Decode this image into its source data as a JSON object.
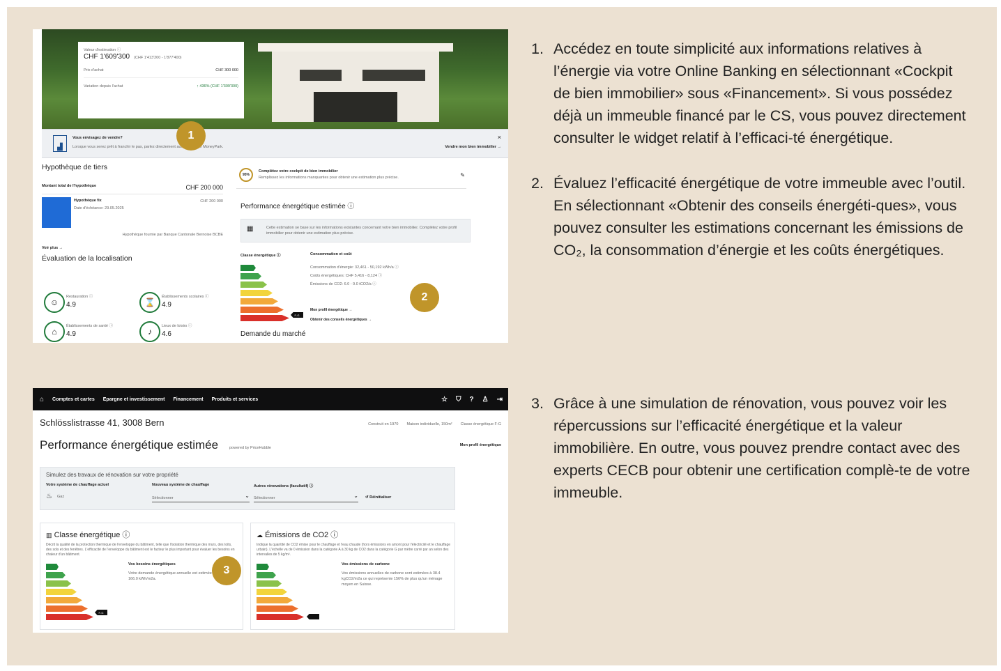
{
  "steps": [
    {
      "num": "1.",
      "text": "Accédez en toute simplicité aux informations relatives à l’énergie via votre Online Banking en sélectionnant «Cockpit de bien immobilier» sous «Financement». Si vous possédez déjà un immeuble financé par le CS, vous pouvez directement consulter le widget relatif à l’efficaci-té énergétique."
    },
    {
      "num": "2.",
      "text": "Évaluez l’efficacité énergétique de votre immeuble avec l’outil. En sélectionnant «Obtenir des conseils énergéti-ques», vous pouvez consulter les estimations concernant les émissions de CO₂, la consommation d’énergie et les coûts énergétiques."
    },
    {
      "num": "3.",
      "text": "Grâce à une simulation de rénovation, vous pouvez voir les répercussions sur l’efficacité énergétique et la valeur immobilière. En outre, vous pouvez prendre contact avec des experts CECB pour obtenir une certification complè-te de votre immeuble."
    }
  ],
  "badges": [
    "1",
    "2",
    "3"
  ],
  "shot1": {
    "estimate_label": "Valeur d'estimation ⓘ",
    "estimate_value": "CHF 1'609'300",
    "estimate_range": "(CHF 1'413'200 - 1'877'400)",
    "purchase_label": "Prix d'achat",
    "purchase_value": "CHF 300 000",
    "change_label": "Variation depuis l'achat",
    "change_value": "↑ 436% (CHF 1'309'300)",
    "banner_title": "Vous envisagez de vendre?",
    "banner_text": "Lorsque vous serez prêt à franchir le pas, parlez directement aux experts de MoneyPark.",
    "banner_link": "Vendre mon bien immobilier →",
    "banner_close": "×",
    "mortgage_title": "Hypothèque de tiers",
    "mortgage_total_label": "Montant total de l'hypothèque",
    "mortgage_total_value": "CHF 200 000",
    "mortgage_item_label": "Hypothèque fix",
    "mortgage_item_date": "Date d'échéance: 29.05.2025",
    "mortgage_item_value": "CHF 200 000",
    "mortgage_provider": "Hypothèque fournie par Banque Cantonale Bernoise BCBE",
    "see_more": "Voir plus →",
    "location_title": "Évaluation de la localisation",
    "loc_items": [
      {
        "label": "Restauration ⓘ",
        "value": "4.9"
      },
      {
        "label": "Établissements scolaires ⓘ",
        "value": "4.9"
      },
      {
        "label": "Établissements de santé ⓘ",
        "value": "4.9"
      },
      {
        "label": "Lieux de loisirs ⓘ",
        "value": "4.6"
      }
    ],
    "complete_pct": "95%",
    "complete_title": "Complétez votre cockpit de bien immobilier",
    "complete_text": "Remplissez les informations manquantes pour obtenir une estimation plus précise.",
    "perf_title": "Performance énergétique estimée ⓘ",
    "info_text": "Cette estimation se base sur les informations existantes concernant votre bien immobilier. Complétez votre profil immobilier pour obtenir une estimation plus précise.",
    "class_label": "Classe énergétique ⓘ",
    "consumption_title": "Consommation et coût",
    "consumption_lines": [
      "Consommation d'énergie: 32,461 - 50,192 kWh/a ⓘ",
      "Coûts énergétiques: CHF 5,416 - 8,124 ⓘ",
      "Émissions de CO2: 6.0 - 9.0 tCO2/a ⓘ"
    ],
    "energy_profile_link": "Mon profil énergétique →",
    "advice_link": "Obtenir des conseils énergétiques →",
    "market_title": "Demande du marché",
    "class_tag": "F-G"
  },
  "shot2": {
    "nav": [
      "Comptes et cartes",
      "Epargne et investissement",
      "Financement",
      "Produits et services"
    ],
    "address": "Schlösslistrasse 41, 3008 Bern",
    "meta": [
      "Construit en 1970",
      "Maison individuelle, 150m²",
      "Classe énergétique F-G"
    ],
    "title": "Performance énergétique estimée",
    "powered": "powered by PriceHubble",
    "profile_link": "Mon profil énergétique",
    "sim_title": "Simulez des travaux de rénovation sur votre propriété",
    "col1_label": "Votre système de chauffage actuel",
    "col1_value": "Gaz",
    "col2_label": "Nouveau système de chauffage",
    "col2_value": "Sélectionner",
    "col3_label": "Autres rénovations (facultatif) ⓘ",
    "col3_value": "Sélectionner",
    "reset": "Réinitialiser",
    "card1_title": "Classe énergétique ⓘ",
    "card1_text": "Décrit la qualité de la protection thermique de l'enveloppe du bâtiment, telle que l'isolation thermique des murs, des toits, des sols et des fenêtres. L'efficacité de l'enveloppe du bâtiment est le facteur le plus important pour évaluer les besoins en chaleur d'un bâtiment.",
    "card1_sub": "Vos besoins énergétiques",
    "card1_subtext": "Votre demande énergétique annuelle est estimée à 166.0 kWh/m2a.",
    "card2_title": "Émissions de CO2 ⓘ",
    "card2_text": "Indique la quantité de CO2 émise pour le chauffage et l'eau chaude (hors émissions en amont pour l'électricité et le chauffage urbain). L'échelle va de 0 émission dans la catégorie A à 30 kg de CO2 dans la catégorie G par mètre carré par an selon des intervalles de 5 kg/m².",
    "card2_sub": "Vos émissions de carbone",
    "card2_subtext": "Vos émissions annuelles de carbone sont estimées à 38.4 kgCO2/m2a ce qui représente 156% de plus qu'un ménage moyen en Suisse.",
    "class_tag": "F-G"
  },
  "colors": {
    "bg": "#ece1d2",
    "badge": "#c0952a",
    "green": "#1f7a3a",
    "nav": "#0f0f10"
  }
}
